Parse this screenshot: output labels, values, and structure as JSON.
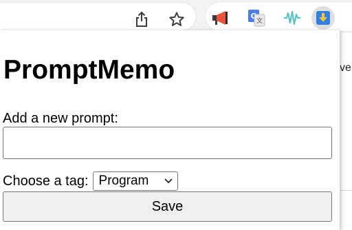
{
  "toolbar": {
    "share_icon": "share-icon",
    "bookmark_icon": "star-icon"
  },
  "extensions": [
    {
      "name": "megaphone-extension-icon"
    },
    {
      "name": "google-translate-icon"
    },
    {
      "name": "audio-wave-icon"
    },
    {
      "name": "download-arrow-icon"
    }
  ],
  "page_peek": {
    "text": "ve"
  },
  "popup": {
    "title": "PromptMemo",
    "new_prompt_label": "Add a new prompt:",
    "prompt_value": "",
    "tag_label": "Choose a tag:",
    "tag_selected": "Program",
    "save_label": "Save"
  },
  "colors": {
    "megaphone": "#e8543a",
    "translate_blue": "#4a7de8",
    "wave": "#5cc3c4",
    "download_bg": "#2f7fe0",
    "download_arrow": "#f6c343"
  }
}
